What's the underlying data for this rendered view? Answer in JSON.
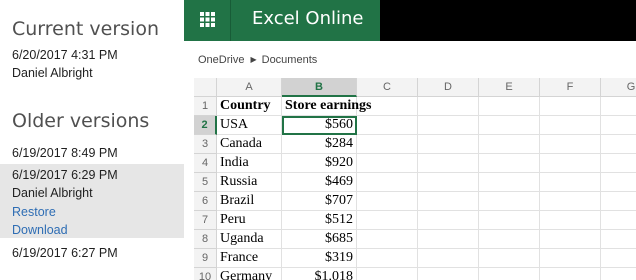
{
  "versions_panel": {
    "current_heading": "Current version",
    "current": {
      "date": "6/20/2017 4:31 PM",
      "author": "Daniel Albright"
    },
    "older_heading": "Older versions",
    "older": [
      {
        "date": "6/19/2017 8:49 PM"
      },
      {
        "date": "6/19/2017 6:29 PM",
        "author": "Daniel Albright",
        "restore": "Restore",
        "download": "Download"
      },
      {
        "date": "6/19/2017 6:27 PM"
      }
    ]
  },
  "app": {
    "title": "Excel Online",
    "brand_color": "#217346",
    "breadcrumb": [
      "OneDrive",
      "Documents"
    ]
  },
  "sheet": {
    "columns": [
      "A",
      "B",
      "C",
      "D",
      "E",
      "F",
      "G"
    ],
    "active_column": "B",
    "active_row": "2",
    "rows": [
      {
        "n": "1",
        "a": "Country",
        "b": "Store earnings"
      },
      {
        "n": "2",
        "a": "USA",
        "b": "$560"
      },
      {
        "n": "3",
        "a": "Canada",
        "b": "$284"
      },
      {
        "n": "4",
        "a": "India",
        "b": "$920"
      },
      {
        "n": "5",
        "a": "Russia",
        "b": "$469"
      },
      {
        "n": "6",
        "a": "Brazil",
        "b": "$707"
      },
      {
        "n": "7",
        "a": "Peru",
        "b": "$512"
      },
      {
        "n": "8",
        "a": "Uganda",
        "b": "$685"
      },
      {
        "n": "9",
        "a": "France",
        "b": "$319"
      },
      {
        "n": "10",
        "a": "Germany",
        "b": "$1,018"
      }
    ]
  }
}
